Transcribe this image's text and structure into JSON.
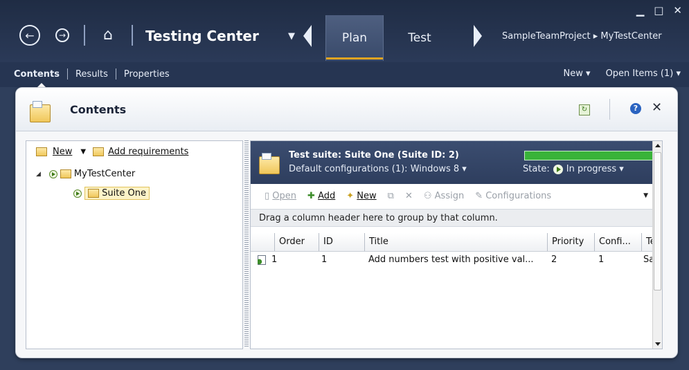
{
  "window": {
    "minimize": "▁",
    "maximize": "□",
    "close": "✕"
  },
  "app": {
    "name": "Testing Center"
  },
  "tabs": [
    {
      "label": "Plan",
      "active": true
    },
    {
      "label": "Test",
      "active": false
    }
  ],
  "breadcrumb": "SampleTeamProject ▸ MyTestCenter",
  "subnav": {
    "items": [
      "Contents",
      "Results",
      "Properties"
    ],
    "active": "Contents"
  },
  "subright": {
    "new_label": "New ▾",
    "open_items": "Open Items (1) ▾"
  },
  "panel": {
    "title": "Contents"
  },
  "left_toolbar": {
    "new_label": "New",
    "add_requirements": "Add requirements"
  },
  "tree": [
    {
      "label": "MyTestCenter"
    },
    {
      "label": "Suite One"
    }
  ],
  "suite": {
    "title": "Test suite:  Suite One (Suite ID: 2)",
    "configs": "Default configurations (1):  Windows 8 ▾",
    "state_label": "State:",
    "state_value": "In progress ▾",
    "progress": 1.0
  },
  "suite_toolbar": {
    "open": "Open",
    "add": "Add",
    "new": "New",
    "assign": "Assign",
    "configurations": "Configurations"
  },
  "group_hint": "Drag a column header here to group by that column.",
  "grid": {
    "columns": [
      "Order",
      "ID",
      "Title",
      "Priority",
      "Confi...",
      "Te"
    ],
    "rows": [
      {
        "order": "1",
        "id": "1",
        "title": "Add numbers test with positive val...",
        "priority": "2",
        "config": "1",
        "tester": "Sa"
      }
    ]
  },
  "colors": {
    "accent": "#e0a421",
    "titlebar": "#1f2c44",
    "progress": "#39b339"
  }
}
